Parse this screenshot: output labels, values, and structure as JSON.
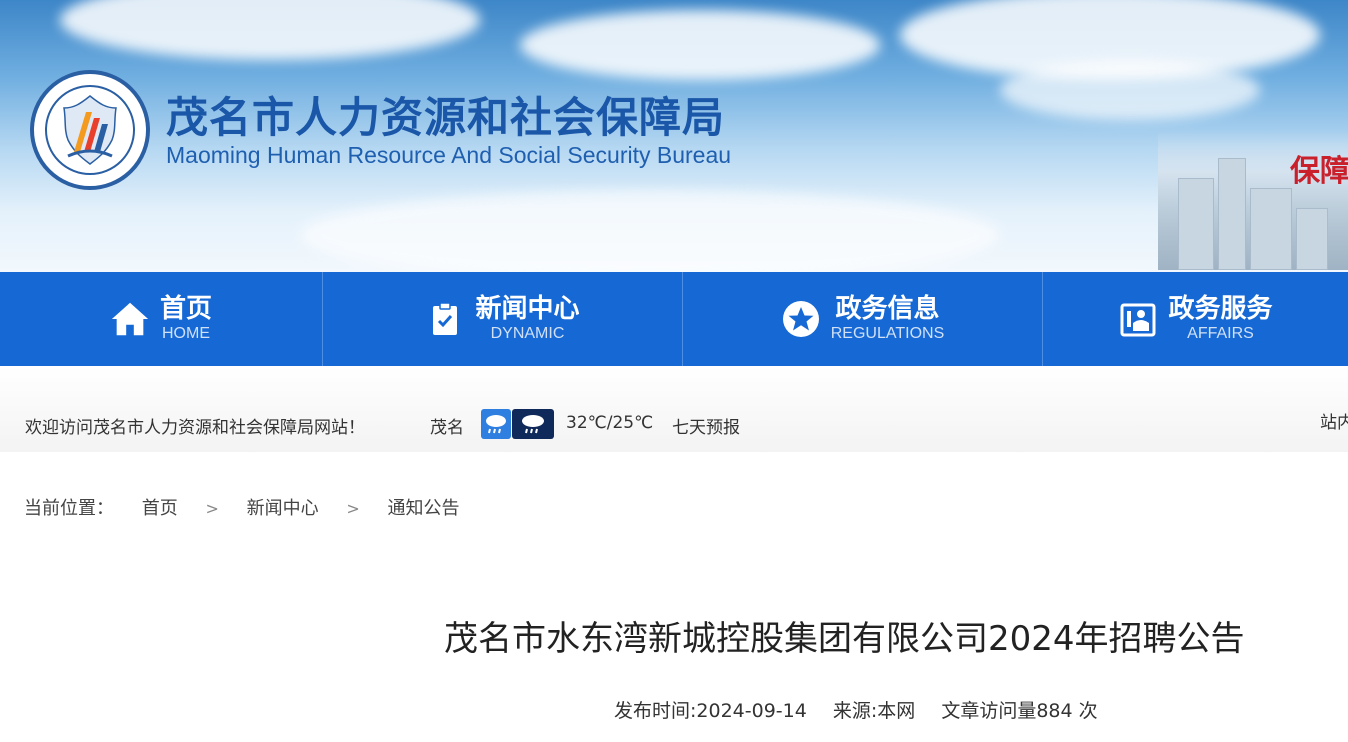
{
  "header": {
    "title_cn": "茂名市人力资源和社会保障局",
    "title_en": "Maoming Human Resource And Social Security Bureau",
    "slogan": "保障"
  },
  "nav": [
    {
      "cn": "首页",
      "en": "HOME",
      "icon": "home-icon"
    },
    {
      "cn": "新闻中心",
      "en": "DYNAMIC",
      "icon": "clipboard-icon"
    },
    {
      "cn": "政务信息",
      "en": "REGULATIONS",
      "icon": "star-icon"
    },
    {
      "cn": "政务服务",
      "en": "AFFAIRS",
      "icon": "service-icon"
    }
  ],
  "welcome": {
    "text": "欢迎访问茂名市人力资源和社会保障局网站！",
    "city": "茂名",
    "temp": "32℃/25℃",
    "forecast": "七天预报",
    "right": "站内"
  },
  "breadcrumb": {
    "label": "当前位置：",
    "items": [
      "首页",
      "新闻中心",
      "通知公告"
    ]
  },
  "article": {
    "title": "茂名市水东湾新城控股集团有限公司2024年招聘公告",
    "publish": "发布时间:2024-09-14",
    "source": "来源:本网",
    "views": "文章访问量884 次"
  },
  "colors": {
    "nav_bg": "#1668d4",
    "title_blue": "#1b57a8"
  }
}
